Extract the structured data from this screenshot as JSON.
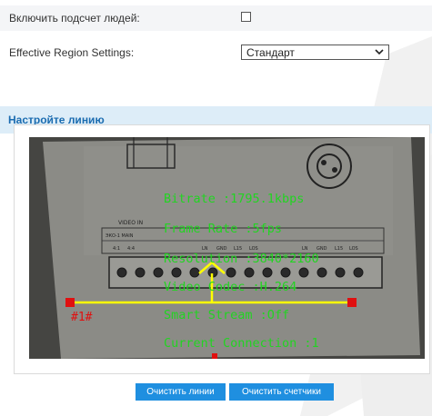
{
  "settings": {
    "people_counting_label": "Включить подсчет людей:",
    "people_counting_checked": false,
    "region_label": "Effective Region Settings:",
    "region_value": "Стандарт"
  },
  "line_section": {
    "title": "Настройте линию"
  },
  "video": {
    "panel_labels": [
      "VIDEO IN",
      "ЭКО-1 MAIN",
      "4:1",
      "4:4",
      "LN",
      "GND",
      "L15",
      "LOS",
      "LN",
      "GND",
      "L15",
      "LOS"
    ],
    "osd": {
      "bitrate": "Bitrate :1795.1kbps",
      "frame_rate": "Frame Rate :5fps",
      "resolution": "Resolution :3840*2160",
      "video_codec": "Video Codec :H.264",
      "smart_stream": "Smart Stream :Off",
      "current_connection": "Current Connection :1"
    },
    "line_label": "#1#",
    "colors": {
      "osd": "#22d422",
      "line": "#ffff00",
      "endpoint": "#e01010",
      "line_label": "#e01010"
    }
  },
  "buttons": {
    "clear_lines": "Очистить линии",
    "clear_counters": "Очистить счетчики"
  },
  "colors": {
    "section_header_bg": "#ddedf8",
    "section_title": "#1b6cb0",
    "button_bg": "#1f8fe0",
    "row_bg": "#f4f5f7"
  }
}
